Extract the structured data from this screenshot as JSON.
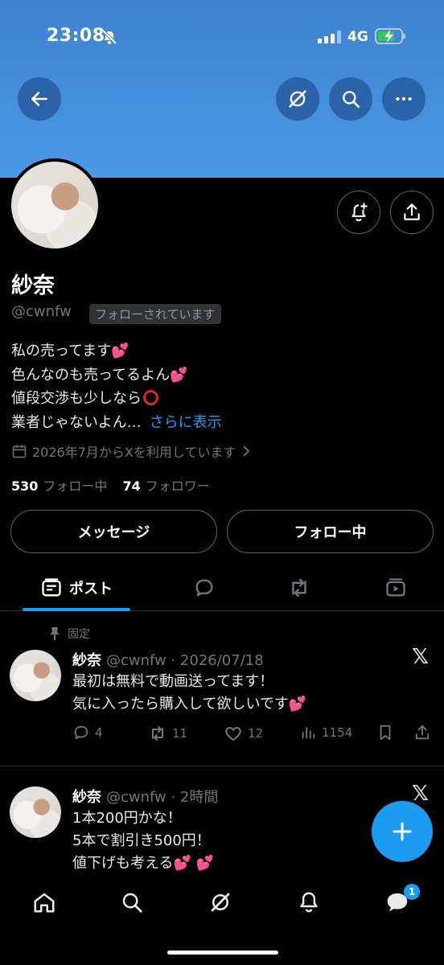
{
  "status_bar": {
    "time": "23:08",
    "network": "4G"
  },
  "profile": {
    "name": "紗奈",
    "handle": "@cwnfw",
    "follows_you": "フォローされています",
    "bio": [
      "私の売ってます",
      "色んなのも売ってるよん",
      "値段交渉も少しなら",
      "業者じゃないよん…"
    ],
    "bio_more": "さらに表示",
    "joined": "2026年7月からXを利用しています",
    "following_count": "530",
    "following_label": "フォロー中",
    "followers_count": "74",
    "followers_label": "フォロワー"
  },
  "buttons": {
    "message": "メッセージ",
    "following": "フォロー中"
  },
  "tabs": {
    "posts": "ポスト"
  },
  "pinned_label": "固定",
  "posts": [
    {
      "name": "紗奈",
      "meta": "@cwnfw · 2026/07/18",
      "lines": [
        "最初は無料で動画送ってます！",
        "気に入ったら購入して欲しいです"
      ],
      "replies": "4",
      "reposts": "11",
      "likes": "12",
      "views": "1154"
    },
    {
      "name": "紗奈",
      "meta": "@cwnfw · 2時間",
      "lines": [
        "1本200円かな！",
        "5本で割引き500円！",
        "値下げも考える"
      ]
    }
  ],
  "bottom_nav": {
    "messages_badge": "1"
  },
  "colors": {
    "accent": "#1d9bf0",
    "banner": "#4a98e6",
    "heart": "#f91880"
  }
}
